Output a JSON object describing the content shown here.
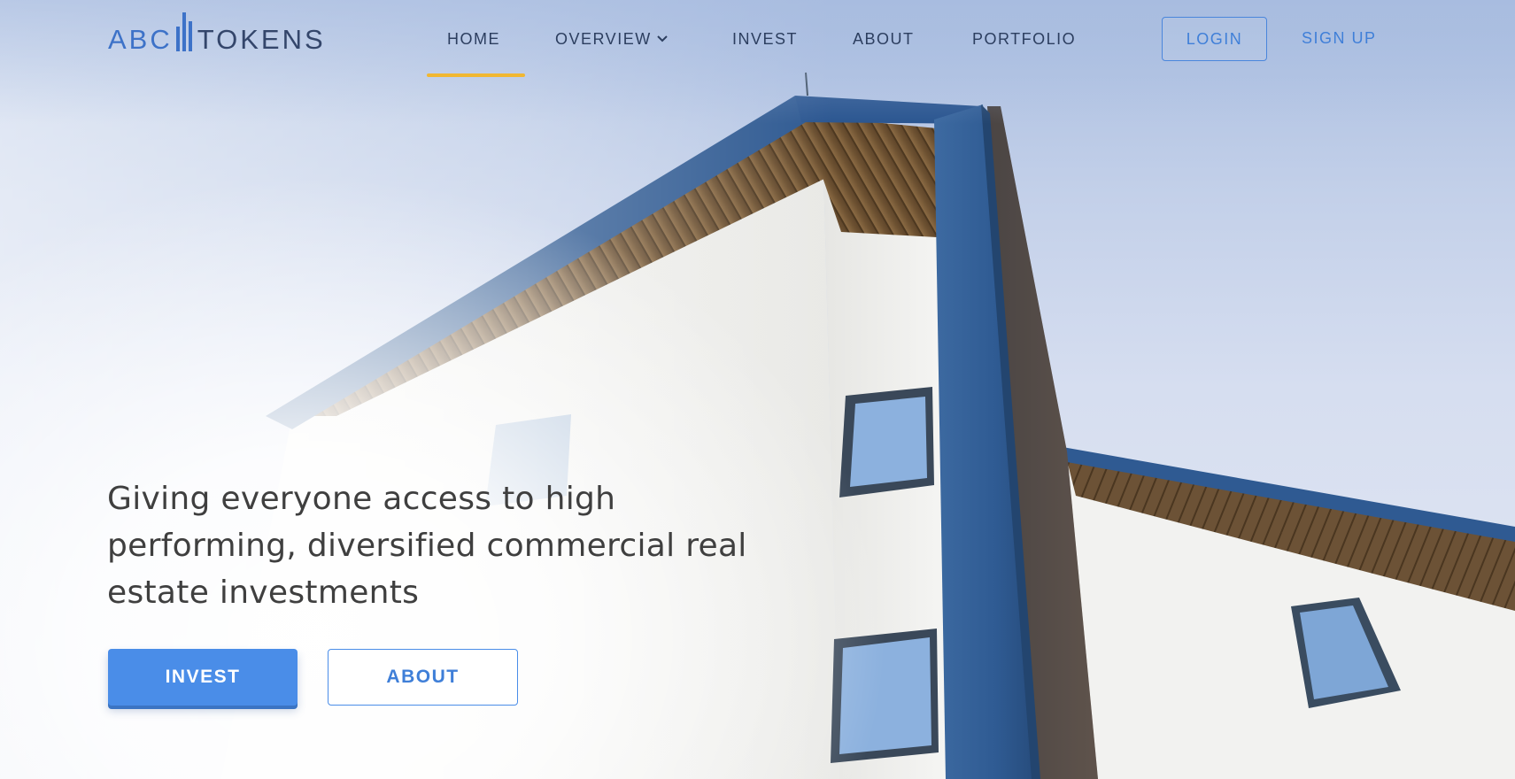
{
  "brand": {
    "name_part1": "ABC",
    "name_part2": "TOKENS",
    "accent_color": "#3d72c8",
    "text_color": "#34466b"
  },
  "nav": {
    "items": [
      {
        "label": "HOME",
        "active": true
      },
      {
        "label": "OVERVIEW",
        "has_dropdown": true
      },
      {
        "label": "INVEST"
      },
      {
        "label": "ABOUT"
      },
      {
        "label": "PORTFOLIO"
      }
    ],
    "dropdown_icon": "chevron-down-icon",
    "active_indicator_color": "#f1b731",
    "login_label": "LOGIN",
    "signup_label": "SIGN UP"
  },
  "hero": {
    "headline": "Giving everyone access to high performing, diversified commercial real estate investments",
    "primary_cta": "INVEST",
    "secondary_cta": "ABOUT",
    "primary_color": "#4a8de8",
    "background_image": "building-photo"
  }
}
